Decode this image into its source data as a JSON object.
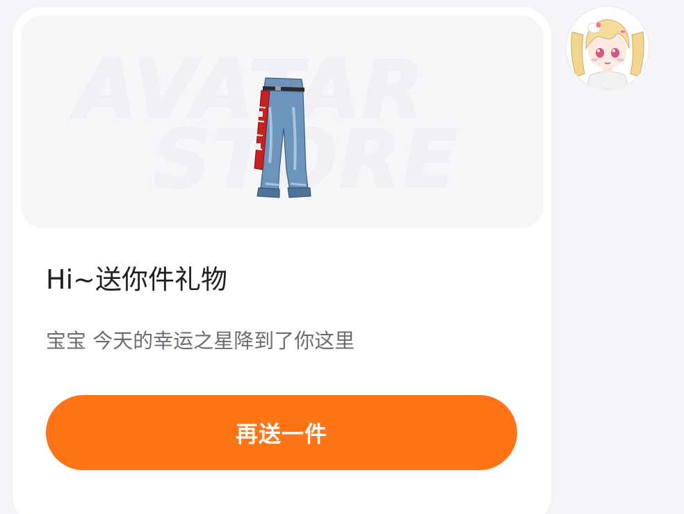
{
  "card": {
    "watermark_line1": "AVATAR",
    "watermark_line2": "STORE",
    "gift_item_icon": "baggy-jeans-icon",
    "title": "Hi~送你件礼物",
    "subtitle": "宝宝 今天的幸运之星降到了你这里",
    "cta_label": "再送一件"
  },
  "avatar": {
    "icon": "anime-girl-avatar"
  },
  "colors": {
    "accent": "#ff7417",
    "title": "#1f1f24",
    "subtitle": "#6c6d74",
    "page_bg": "#f4f5f8",
    "banner_bg": "#f6f6f9"
  }
}
